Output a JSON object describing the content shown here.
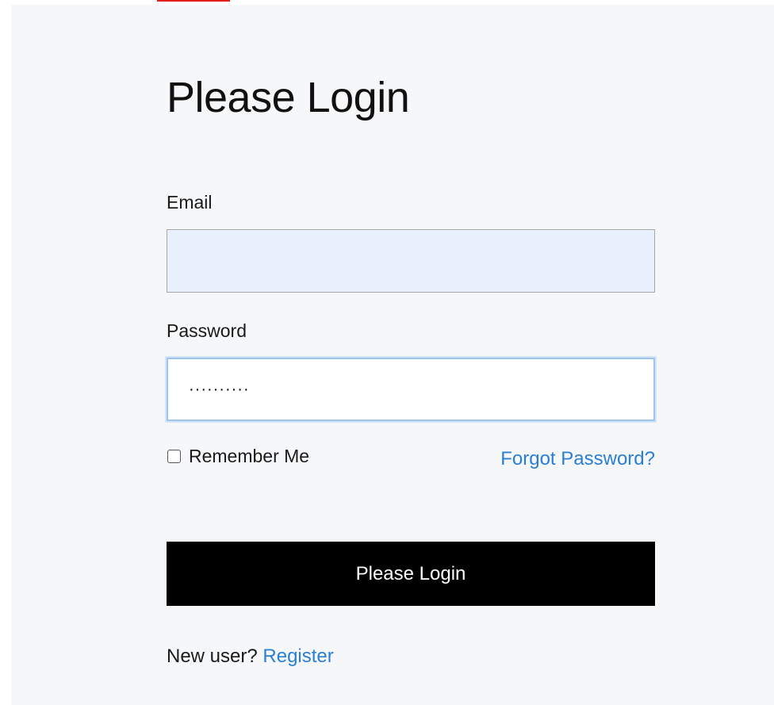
{
  "page": {
    "title": "Please Login"
  },
  "email": {
    "label": "Email",
    "value": ""
  },
  "password": {
    "label": "Password",
    "value": "··········"
  },
  "remember": {
    "label": "Remember Me",
    "checked": false
  },
  "forgot": {
    "label": "Forgot Password?"
  },
  "submit": {
    "label": "Please Login"
  },
  "register": {
    "prompt": "New user?",
    "link_label": "Register"
  },
  "colors": {
    "link": "#2a7fd4",
    "button_bg": "#000000",
    "autofill_bg": "#e8f0fe",
    "focus_border": "#9ec5f2",
    "annotation_red": "#e0201b"
  }
}
